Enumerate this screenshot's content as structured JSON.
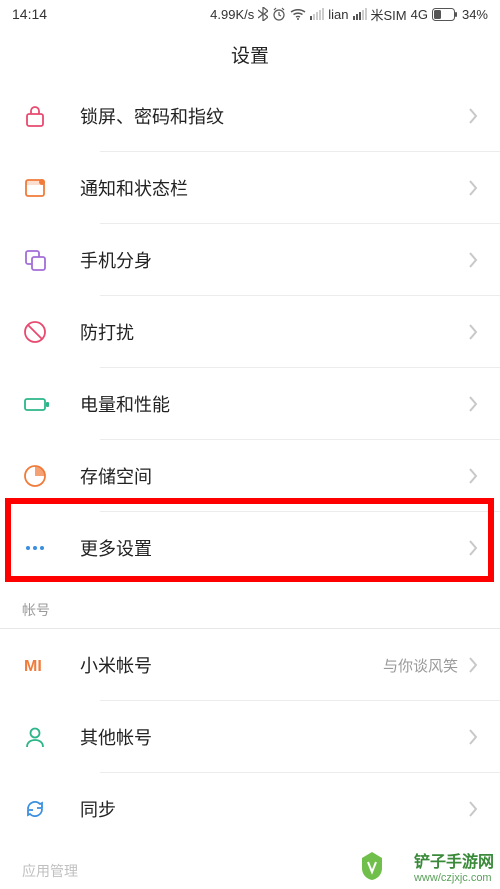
{
  "status": {
    "time": "14:14",
    "speed": "4.99K/s",
    "carrier": "lian",
    "sim_label": "米SIM",
    "network": "4G",
    "battery_pct": "34%"
  },
  "header": {
    "title": "设置"
  },
  "rows": [
    {
      "label": "锁屏、密码和指纹"
    },
    {
      "label": "通知和状态栏"
    },
    {
      "label": "手机分身"
    },
    {
      "label": "防打扰"
    },
    {
      "label": "电量和性能"
    },
    {
      "label": "存储空间"
    },
    {
      "label": "更多设置"
    }
  ],
  "section_accounts": {
    "label": "帐号"
  },
  "account_rows": [
    {
      "label": "小米帐号",
      "value": "与你谈风笑"
    },
    {
      "label": "其他帐号"
    },
    {
      "label": "同步"
    }
  ],
  "section_apps": {
    "label": "应用管理"
  },
  "watermark": {
    "line1": "铲子手游网",
    "line2": "www/czjxjc.com"
  }
}
